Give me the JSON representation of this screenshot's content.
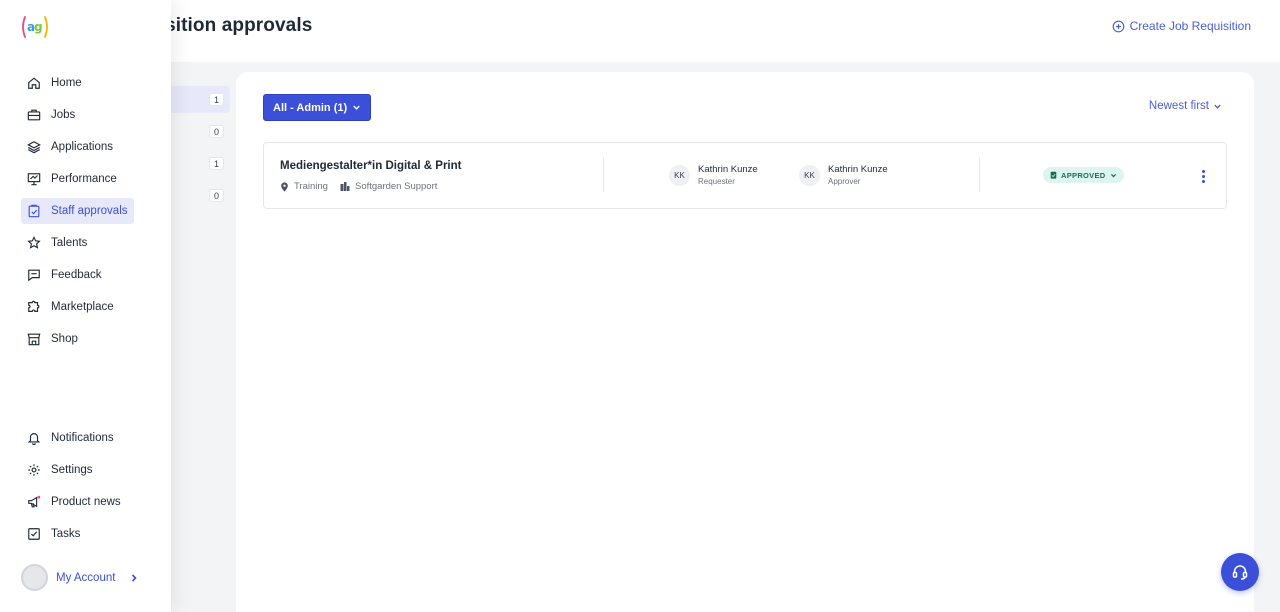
{
  "header": {
    "title": "uisition approvals",
    "create_label": "Create Job Requisition"
  },
  "filters": {
    "counts": [
      "1",
      "0",
      "1",
      "0"
    ]
  },
  "toolbar": {
    "admin_filter_label": "All - Admin (1)",
    "sort_label": "Newest first"
  },
  "requisition": {
    "title": "Mediengestalter*in Digital & Print",
    "location": "Training",
    "department": "Softgarden Support",
    "requester": {
      "initials": "KK",
      "name": "Kathrin Kunze",
      "role": "Requester"
    },
    "approver": {
      "initials": "KK",
      "name": "Kathrin Kunze",
      "role": "Approver"
    },
    "status": "APPROVED"
  },
  "sidebar": {
    "logo_text": "(ag)",
    "items": [
      {
        "label": "Home",
        "icon": "home-icon"
      },
      {
        "label": "Jobs",
        "icon": "briefcase-icon"
      },
      {
        "label": "Applications",
        "icon": "layers-icon"
      },
      {
        "label": "Performance",
        "icon": "presentation-icon"
      },
      {
        "label": "Staff approvals",
        "icon": "clipboard-check-icon"
      },
      {
        "label": "Talents",
        "icon": "star-icon"
      },
      {
        "label": "Feedback",
        "icon": "chat-icon"
      },
      {
        "label": "Marketplace",
        "icon": "puzzle-icon"
      },
      {
        "label": "Shop",
        "icon": "store-icon"
      }
    ],
    "bottom_items": [
      {
        "label": "Notifications",
        "icon": "bell-icon"
      },
      {
        "label": "Settings",
        "icon": "gear-icon"
      },
      {
        "label": "Product news",
        "icon": "megaphone-icon"
      },
      {
        "label": "Tasks",
        "icon": "checkbox-icon"
      }
    ],
    "account_label": "My Account"
  },
  "colors": {
    "accent": "#3b4fd8",
    "status_bg": "#dcf5ee",
    "status_text": "#1b6b54"
  }
}
